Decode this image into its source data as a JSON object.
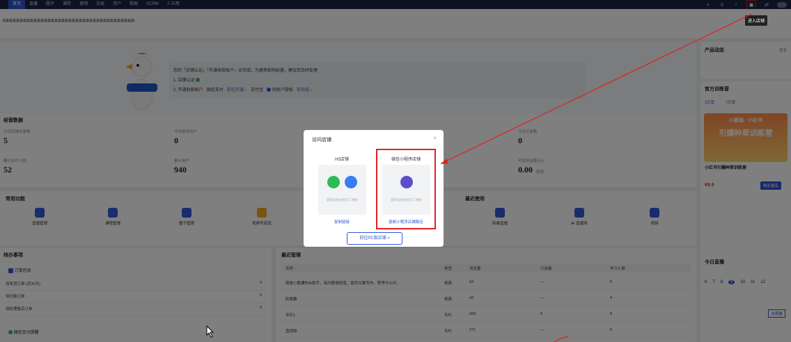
{
  "nav": {
    "tabs": [
      "首页",
      "直播",
      "圈子",
      "课程",
      "营销",
      "交易",
      "用户",
      "数据",
      "SCRM",
      "应用"
    ],
    "active_index": 0
  },
  "tooltip": "进入店铺",
  "notice": {
    "text1": "您的「店铺认证」「开通收款账户」未完成，为避免影响经营，建议您及时处理",
    "step1": "1. 店铺认证",
    "step2_label": "2. 开通收款账户",
    "wechat_pay": "微信支付",
    "go_open": "前往开通",
    "alipay": "支付宝",
    "pending": "待商户授权",
    "go_finish": "去完成"
  },
  "biz": {
    "title": "经营数据",
    "stats": [
      {
        "label": "今日店铺访客数",
        "value": "5"
      },
      {
        "label": "今日新增用户",
        "value": "0"
      },
      {
        "label": "今日订单数",
        "value": "0"
      },
      {
        "label": "累计支付人数",
        "value": "52"
      },
      {
        "label": "累计用户",
        "value": "940"
      },
      {
        "label": "可提现金额(元)",
        "value": "0.00"
      }
    ],
    "withdraw": "提现"
  },
  "common": {
    "title": "常用功能",
    "items": [
      "直播管理",
      "课程管理",
      "圈子管理",
      "视频号变现"
    ],
    "recent_title": "最近使用",
    "recent_items": [
      "新建直播",
      "AI 直播场",
      "视频"
    ]
  },
  "todo": {
    "title": "待办事项",
    "order_title": "订单信息",
    "rows": [
      {
        "label": "待发货订单 (近30天)",
        "count": "0"
      },
      {
        "label": "待付款订单",
        "count": "0"
      },
      {
        "label": "待处理售后订单",
        "count": "0"
      }
    ],
    "wechat_title": "微信支付提醒"
  },
  "recent": {
    "title": "最近管理",
    "headers": [
      "名称",
      "类型",
      "浏览量",
      "订阅量",
      "学习人数"
    ],
    "rows": [
      {
        "name": "我是小鹅通的AI助手，有问题请知道，提供文案写作，思考什么问…",
        "type": "视频",
        "views": "54",
        "subs": "—",
        "learners": "0"
      },
      {
        "name": "防爬搬",
        "type": "视频",
        "views": "43",
        "subs": "—",
        "learners": "4"
      },
      {
        "name": "专栏1",
        "type": "专栏",
        "views": "509",
        "subs": "0",
        "learners": "8"
      },
      {
        "name": "直视频",
        "type": "专栏",
        "views": "271",
        "subs": "—",
        "learners": "5"
      }
    ]
  },
  "right": {
    "news_title": "产品动态",
    "more": "更多",
    "training_title": "官方训练营",
    "training_tabs": [
      "3天营",
      "7天营"
    ],
    "banner_top": "小鹅通 · 小红书",
    "banner_main": "引爆种草训练营",
    "course_title": "小红书引爆种草训练营",
    "price": "¥9.9",
    "buy": "购买报名",
    "live_title": "今日直播",
    "dates": [
      "6",
      "7",
      "8",
      "9",
      "10",
      "11",
      "12"
    ],
    "live_link": "去观看"
  },
  "modal": {
    "title": "访问店铺",
    "close": "×",
    "h5_title": "H5店铺",
    "h5_hint": "复制该地址显示二维码",
    "h5_link": "复制链接",
    "mini_title": "微信小程序店铺",
    "mini_hint": "复制该地址显示二维码",
    "mini_link": "复制小程序店铺路径",
    "pc_button": "前往PC版店铺 >"
  },
  "colors": {
    "nav_bg": "#1c2340",
    "accent": "#3056d3",
    "highlight": "#e02020",
    "wechat_green": "#2dbb55",
    "mini_purple": "#5b4fc9"
  }
}
